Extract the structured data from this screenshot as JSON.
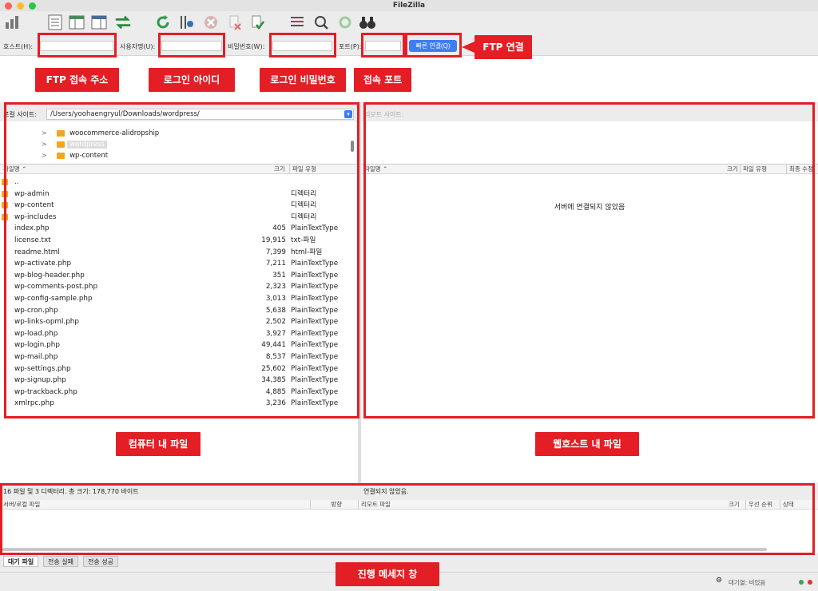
{
  "app": {
    "title": "FileZilla"
  },
  "quickconnect": {
    "host_label": "호스트(H):",
    "user_label": "사용자명(U):",
    "pass_label": "비밀번호(W):",
    "port_label": "포트(P):",
    "connect_label": "빠른 연결(Q)"
  },
  "local": {
    "site_label": "로컬 사이트:",
    "path": "/Users/yoohaengryul/Downloads/wordpress/",
    "tree": [
      {
        "name": "woocommerce-alidropship",
        "selected": false
      },
      {
        "name": "wordpress",
        "selected": true
      },
      {
        "name": "wp-content",
        "selected": false
      }
    ],
    "columns": {
      "name": "파일명",
      "size": "크기",
      "type": "파일 유형"
    },
    "files": [
      {
        "name": "..",
        "size": "",
        "type": "",
        "folder": true
      },
      {
        "name": "wp-admin",
        "size": "",
        "type": "디렉터리",
        "folder": true
      },
      {
        "name": "wp-content",
        "size": "",
        "type": "디렉터리",
        "folder": true
      },
      {
        "name": "wp-includes",
        "size": "",
        "type": "디렉터리",
        "folder": true
      },
      {
        "name": "index.php",
        "size": "405",
        "type": "PlainTextType",
        "folder": false
      },
      {
        "name": "license.txt",
        "size": "19,915",
        "type": "txt-파일",
        "folder": false
      },
      {
        "name": "readme.html",
        "size": "7,399",
        "type": "html-파일",
        "folder": false
      },
      {
        "name": "wp-activate.php",
        "size": "7,211",
        "type": "PlainTextType",
        "folder": false
      },
      {
        "name": "wp-blog-header.php",
        "size": "351",
        "type": "PlainTextType",
        "folder": false
      },
      {
        "name": "wp-comments-post.php",
        "size": "2,323",
        "type": "PlainTextType",
        "folder": false
      },
      {
        "name": "wp-config-sample.php",
        "size": "3,013",
        "type": "PlainTextType",
        "folder": false
      },
      {
        "name": "wp-cron.php",
        "size": "5,638",
        "type": "PlainTextType",
        "folder": false
      },
      {
        "name": "wp-links-opml.php",
        "size": "2,502",
        "type": "PlainTextType",
        "folder": false
      },
      {
        "name": "wp-load.php",
        "size": "3,927",
        "type": "PlainTextType",
        "folder": false
      },
      {
        "name": "wp-login.php",
        "size": "49,441",
        "type": "PlainTextType",
        "folder": false
      },
      {
        "name": "wp-mail.php",
        "size": "8,537",
        "type": "PlainTextType",
        "folder": false
      },
      {
        "name": "wp-settings.php",
        "size": "25,602",
        "type": "PlainTextType",
        "folder": false
      },
      {
        "name": "wp-signup.php",
        "size": "34,385",
        "type": "PlainTextType",
        "folder": false
      },
      {
        "name": "wp-trackback.php",
        "size": "4,885",
        "type": "PlainTextType",
        "folder": false
      },
      {
        "name": "xmlrpc.php",
        "size": "3,236",
        "type": "PlainTextType",
        "folder": false
      }
    ],
    "status": "16 파일 및 3 디렉터리. 총 크기: 178,770 바이트"
  },
  "remote": {
    "site_label": "리모트 사이트:",
    "columns": {
      "name": "파일명",
      "size": "크기",
      "type": "파일 유형",
      "modified": "최종 수정"
    },
    "empty_message": "서버에 연결되지 않았음",
    "status": "연결되지 않았음."
  },
  "queue": {
    "columns": {
      "local": "서버/로컬 파일",
      "direction": "방향",
      "remote": "리모트 파일",
      "size": "크기",
      "priority": "우선 순위",
      "state": "상태"
    },
    "tabs": [
      "대기 파일",
      "전송 실패",
      "전송 성공"
    ],
    "footer": "대기열: 비었음"
  },
  "annotations": {
    "ftp_address": "FTP 접속 주소",
    "login_id": "로그인 아이디",
    "login_password": "로그인 비밀번호",
    "port": "접속 포트",
    "ftp_connect": "FTP 연결",
    "local_files": "컴퓨터 내 파일",
    "remote_files": "웹호스트 내 파일",
    "message_window": "진행 메세지 창"
  },
  "colors": {
    "annotation_red": "#e31e24",
    "connect_blue": "#3d7ef0",
    "folder": "#f3a520"
  }
}
